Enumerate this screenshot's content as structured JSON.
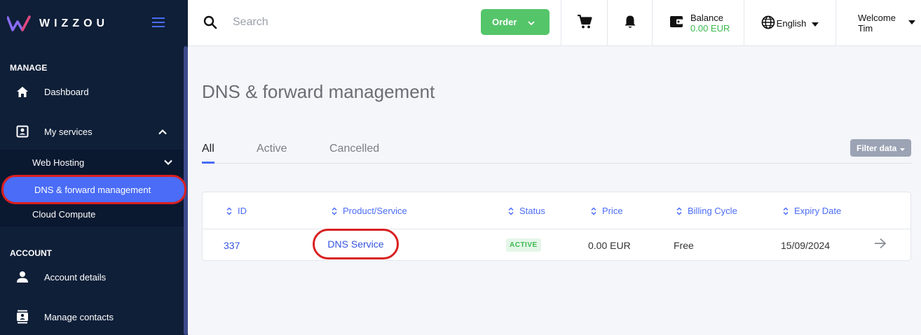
{
  "brand": {
    "name": "WIZZOU"
  },
  "sidebar": {
    "sections": [
      {
        "title": "MANAGE"
      },
      {
        "title": "ACCOUNT"
      }
    ],
    "items": {
      "dashboard": "Dashboard",
      "my_services": "My services",
      "account_details": "Account details",
      "manage_contacts": "Manage contacts"
    },
    "submenu": {
      "web_hosting": "Web Hosting",
      "dns_forward": "DNS & forward management",
      "cloud_compute": "Cloud Compute"
    }
  },
  "topbar": {
    "search_placeholder": "Search",
    "order_label": "Order",
    "balance_label": "Balance",
    "balance_value": "0.00 EUR",
    "language": "English",
    "welcome_line1": "Welcome",
    "welcome_line2": "Tim"
  },
  "main": {
    "title": "DNS & forward management",
    "tabs": [
      "All",
      "Active",
      "Cancelled"
    ],
    "filter_label": "Filter data"
  },
  "table": {
    "columns": [
      "ID",
      "Product/Service",
      "Status",
      "Price",
      "Billing Cycle",
      "Expiry Date"
    ],
    "rows": [
      {
        "id": "337",
        "product": "DNS Service",
        "status": "ACTIVE",
        "price": "0.00 EUR",
        "billing": "Free",
        "expiry": "15/09/2024"
      }
    ]
  },
  "colors": {
    "sidebar_bg": "#0f1f38",
    "accent": "#4a6cf7",
    "success": "#55c56a",
    "highlight_ring": "#d92020"
  }
}
